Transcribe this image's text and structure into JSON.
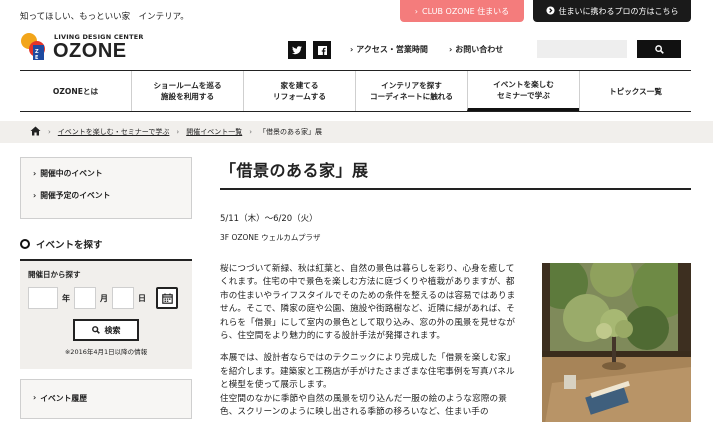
{
  "header": {
    "tagline": "知ってほしい、もっといい家　インテリア。",
    "club_button": "CLUB OZONE 住まいる",
    "pro_button": "住まいに携わるプロの方はこちら",
    "logo_sub": "LIVING DESIGN CENTER",
    "logo_main": "OZONE",
    "social_twitter": "twitter-icon",
    "social_facebook": "facebook-icon",
    "access_link": "アクセス・営業時間",
    "contact_link": "お問い合わせ",
    "search_placeholder": ""
  },
  "nav": {
    "items": [
      {
        "line1": "OZONEとは",
        "line2": ""
      },
      {
        "line1": "ショールームを巡る",
        "line2": "施設を利用する"
      },
      {
        "line1": "家を建てる",
        "line2": "リフォームする"
      },
      {
        "line1": "インテリアを探す",
        "line2": "コーディネートに触れる"
      },
      {
        "line1": "イベントを楽しむ",
        "line2": "セミナーで学ぶ"
      },
      {
        "line1": "トピックス一覧",
        "line2": ""
      }
    ]
  },
  "breadcrumb": {
    "items": [
      "イベントを楽しむ・セミナーで学ぶ",
      "開催イベント一覧",
      "「借景のある家」展"
    ]
  },
  "sidebar": {
    "current_events": "開催中のイベント",
    "upcoming_events": "開催予定のイベント",
    "find_title": "イベントを探す",
    "date_label": "開催日から探す",
    "year_unit": "年",
    "month_unit": "月",
    "day_unit": "日",
    "search_button": "検索",
    "note": "※2016年4月1日以降の情報",
    "history": "イベント履歴"
  },
  "main": {
    "title": "「借景のある家」展",
    "date": "5/11（木）〜6/20（火）",
    "venue": "3F OZONE ウェルカムプラザ",
    "paragraph1": "桜につづいて新緑、秋は紅葉と、自然の景色は暮らしを彩り、心身を癒してくれます。住宅の中で景色を楽しむ方法に庭づくりや植栽がありますが、都市の住まいやライフスタイルでそのための条件を整えるのは容易ではありません。そこで、隣家の庭や公園、施設や街路樹など、近隣に緑があれば、それらを「借景」にして室内の景色として取り込み、窓の外の風景を見せながら、住空間をより魅力的にする設計手法が発揮されます。",
    "paragraph2": "本展では、設計者ならではのテクニックにより完成した「借景を楽しむ家」を紹介します。建築家と工務店が手がけたさまざまな住宅事例を写真パネルと模型を使って展示します。",
    "paragraph3": "住空間のなかに季節や自然の風景を切り込んだ一服の絵のような窓際の景色、スクリーンのように映し出される季節の移ろいなど、住まい手の"
  },
  "colors": {
    "club_button_bg": "#f47c7c",
    "pro_button_bg": "#1a1a1a",
    "breadcrumb_bg": "#f1efec"
  }
}
